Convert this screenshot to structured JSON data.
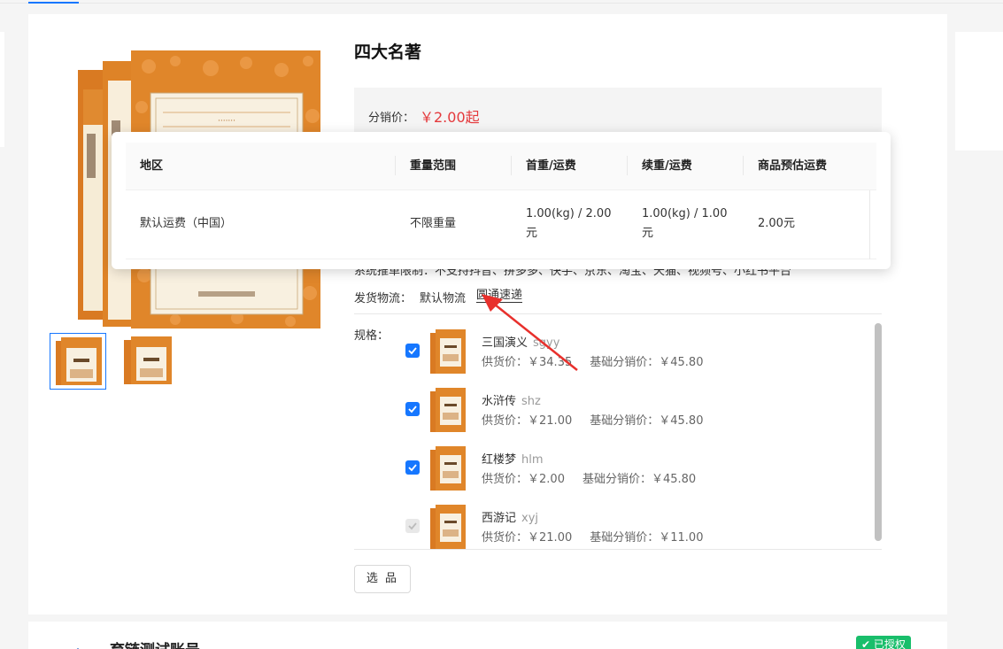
{
  "product": {
    "title": "四大名著",
    "price_label": "分销价：",
    "price_value": "￥2.00起",
    "platform_line": "系统推单限制：不支持抖音、拼多多、快手、京东、淘宝、天猫、视频号、小红书平台",
    "shipping_label": "发货物流：",
    "shipping_options": [
      "默认物流",
      "圆通速递"
    ],
    "spec_label": "规格：",
    "select_button": "选 品"
  },
  "specs": [
    {
      "name": "三国演义",
      "code": "sgyy",
      "supply_label": "供货价：",
      "supply": "￥34.35",
      "base_label": "基础分销价：",
      "base": "￥45.80",
      "checked": true
    },
    {
      "name": "水浒传",
      "code": "shz",
      "supply_label": "供货价：",
      "supply": "￥21.00",
      "base_label": "基础分销价：",
      "base": "￥45.80",
      "checked": true
    },
    {
      "name": "红楼梦",
      "code": "hlm",
      "supply_label": "供货价：",
      "supply": "￥2.00",
      "base_label": "基础分销价：",
      "base": "￥45.80",
      "checked": true
    },
    {
      "name": "西游记",
      "code": "xyj",
      "supply_label": "供货价：",
      "supply": "￥21.00",
      "base_label": "基础分销价：",
      "base": "￥11.00",
      "checked": false
    }
  ],
  "freight_table": {
    "headers": [
      "地区",
      "重量范围",
      "首重/运费",
      "续重/运费",
      "商品预估运费"
    ],
    "rows": [
      [
        "默认运费（中国）",
        "不限重量",
        "1.00(kg) / 2.00元",
        "1.00(kg) / 1.00元",
        "2.00元"
      ]
    ]
  },
  "bottom": {
    "account_name": "育链测试账号",
    "badge": "已授权"
  },
  "colors": {
    "accent": "#1677ff",
    "price": "#e4393c",
    "book_orange": "#e0862a",
    "badge_green": "#19be6b",
    "arrow_red": "#e8302c"
  }
}
